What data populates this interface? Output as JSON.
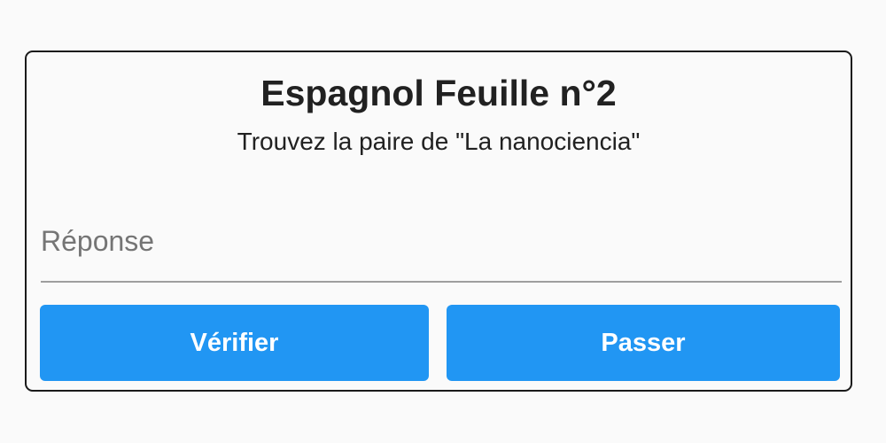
{
  "card": {
    "title": "Espagnol Feuille n°2",
    "prompt": "Trouvez la paire de \"La nanociencia\""
  },
  "answer": {
    "placeholder": "Réponse",
    "value": ""
  },
  "actions": {
    "verify_label": "Vérifier",
    "skip_label": "Passer"
  },
  "colors": {
    "primary": "#2196f3",
    "background": "#fafafa",
    "border": "#1a1a1a",
    "underline": "#9e9e9e"
  }
}
